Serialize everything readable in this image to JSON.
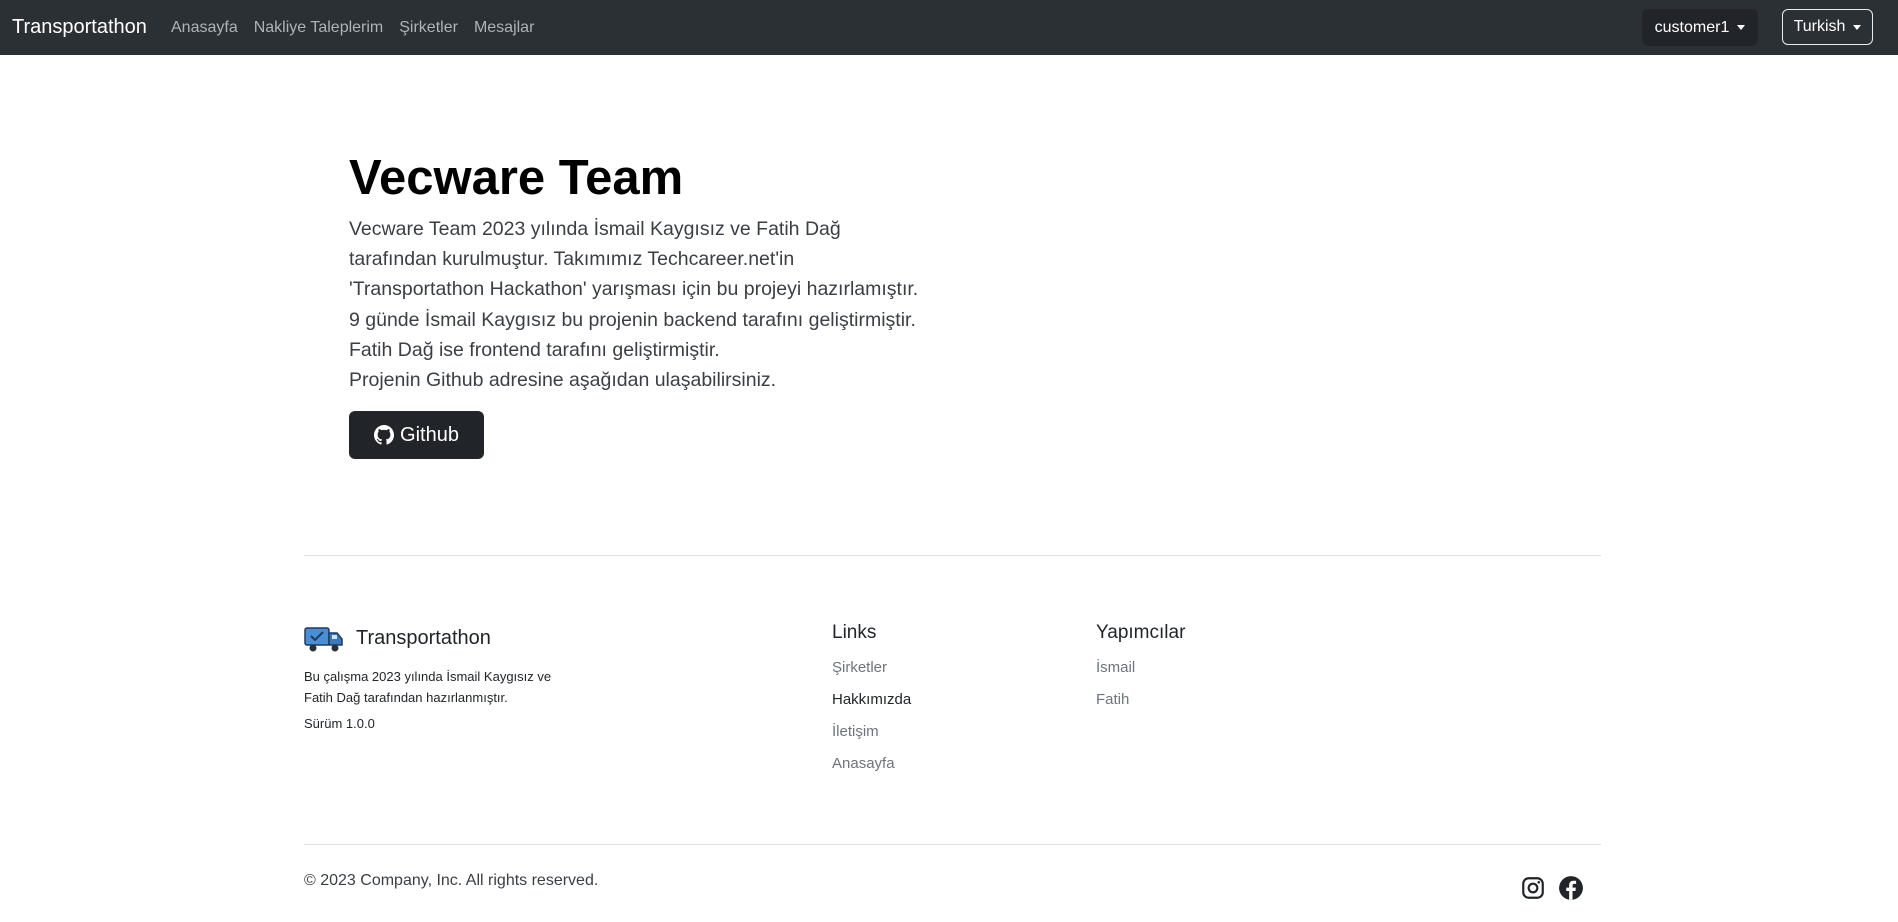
{
  "navbar": {
    "brand": "Transportathon",
    "links": [
      "Anasayfa",
      "Nakliye Taleplerim",
      "Şirketler",
      "Mesajlar"
    ],
    "user_menu": "customer1",
    "language": "Turkish"
  },
  "hero": {
    "title": "Vecware Team",
    "description": "Vecware Team 2023 yılında İsmail Kaygısız ve Fatih Dağ tarafından kurulmuştur. Takımımız Techcareer.net'in 'Transportathon Hackathon' yarışması için bu projeyi hazırlamıştır. 9 günde İsmail Kaygısız bu projenin backend tarafını geliştirmiştir. Fatih Dağ ise frontend tarafını geliştirmiştir.",
    "github_note": "Projenin Github adresine aşağıdan ulaşabilirsiniz.",
    "github_button": "Github"
  },
  "footer": {
    "brand": "Transportathon",
    "description": "Bu çalışma 2023 yılında İsmail Kaygısız ve Fatih Dağ tarafından hazırlanmıştır.",
    "version": "Sürüm 1.0.0",
    "links": {
      "title": "Links",
      "items": [
        "Şirketler",
        "Hakkımızda",
        "İletişim",
        "Anasayfa"
      ]
    },
    "makers": {
      "title": "Yapımcılar",
      "items": [
        "İsmail",
        "Fatih"
      ]
    },
    "copyright": "© 2023 Company, Inc. All rights reserved.",
    "social": [
      "instagram-icon",
      "facebook-icon"
    ]
  },
  "colors": {
    "navbar_bg": "#2b3035",
    "button_dark": "#212529",
    "muted_link": "#6c757d"
  }
}
